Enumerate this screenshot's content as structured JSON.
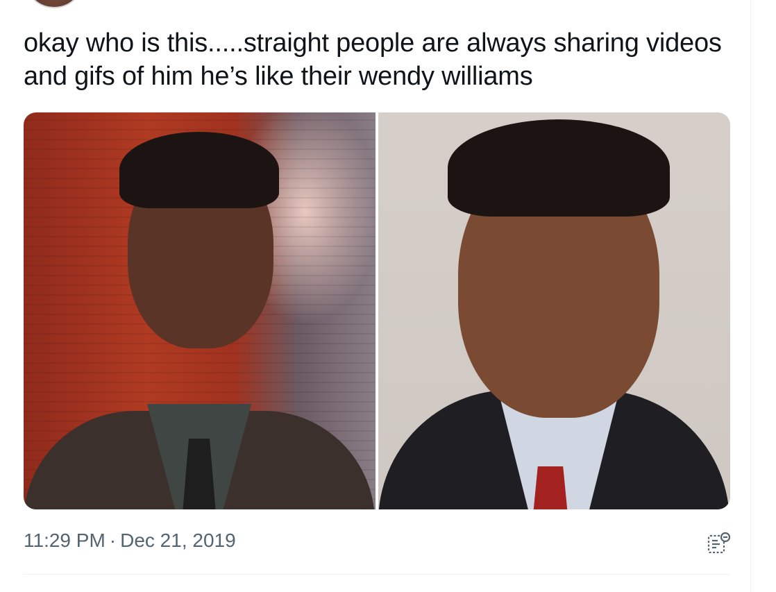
{
  "tweet": {
    "text": "okay who is this.....straight people are always sharing videos and gifs of him he’s like their wendy williams",
    "time": "11:29 PM",
    "separator": "·",
    "date": "Dec 21, 2019"
  },
  "icons": {
    "analytics": "view-analytics-icon"
  },
  "colors": {
    "text": "#0f1419",
    "muted": "#536471",
    "border": "#eff3f4"
  }
}
